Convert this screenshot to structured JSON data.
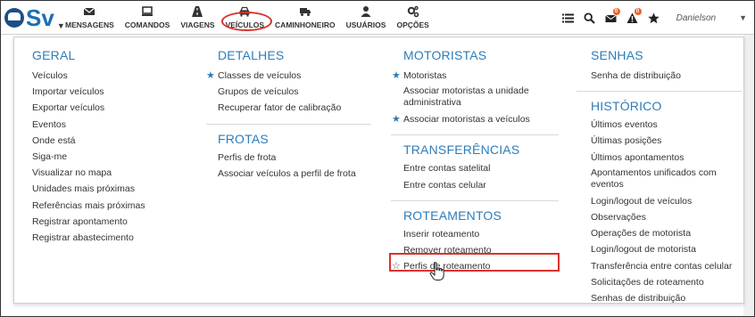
{
  "app": {
    "logo_text": "Sv"
  },
  "nav": [
    {
      "label": "MENSAGENS",
      "icon": "envelope-icon"
    },
    {
      "label": "COMANDOS",
      "icon": "monitor-icon"
    },
    {
      "label": "VIAGENS",
      "icon": "road-icon"
    },
    {
      "label": "VEÍCULOS",
      "icon": "car-icon",
      "active": true
    },
    {
      "label": "CAMINHONEIRO",
      "icon": "truck-icon"
    },
    {
      "label": "USUÁRIOS",
      "icon": "user-icon"
    },
    {
      "label": "OPÇÕES",
      "icon": "gears-icon"
    }
  ],
  "toolbar": {
    "user": "Danielson",
    "mail_badge": "0",
    "alert_badge": "0"
  },
  "menu": {
    "geral": {
      "title": "GERAL",
      "items": [
        "Veículos",
        "Importar veículos",
        "Exportar veículos",
        "Eventos",
        "Onde está",
        "Siga-me",
        "Visualizar no mapa",
        "Unidades mais próximas",
        "Referências mais próximas",
        "Registrar apontamento",
        "Registrar abastecimento"
      ]
    },
    "detalhes": {
      "title": "DETALHES",
      "items": [
        "Classes de veículos",
        "Grupos de veículos",
        "Recuperar fator de calibração"
      ]
    },
    "frotas": {
      "title": "FROTAS",
      "items": [
        "Perfis de frota",
        "Associar veículos a perfil de frota"
      ]
    },
    "motoristas": {
      "title": "MOTORISTAS",
      "items": [
        "Motoristas",
        "Associar motoristas a unidade administrativa",
        "Associar motoristas a veículos"
      ]
    },
    "transferencias": {
      "title": "TRANSFERÊNCIAS",
      "items": [
        "Entre contas satelital",
        "Entre contas celular"
      ]
    },
    "roteamentos": {
      "title": "ROTEAMENTOS",
      "items": [
        "Inserir roteamento",
        "Remover roteamento",
        "Perfis de roteamento"
      ]
    },
    "senhas": {
      "title": "SENHAS",
      "items": [
        "Senha de distribuição"
      ]
    },
    "historico": {
      "title": "HISTÓRICO",
      "items": [
        "Últimos eventos",
        "Últimas posições",
        "Últimos apontamentos",
        "Apontamentos unificados com eventos",
        "Login/logout de veículos",
        "Observações",
        "Operações de motorista",
        "Login/logout de motorista",
        "Transferência entre contas celular",
        "Solicitações de roteamento",
        "Senhas de distribuição"
      ]
    }
  },
  "colors": {
    "accent": "#2e7cb8",
    "highlight": "#d9322d",
    "badge": "#e8622a",
    "logo": "#1c4f86"
  }
}
